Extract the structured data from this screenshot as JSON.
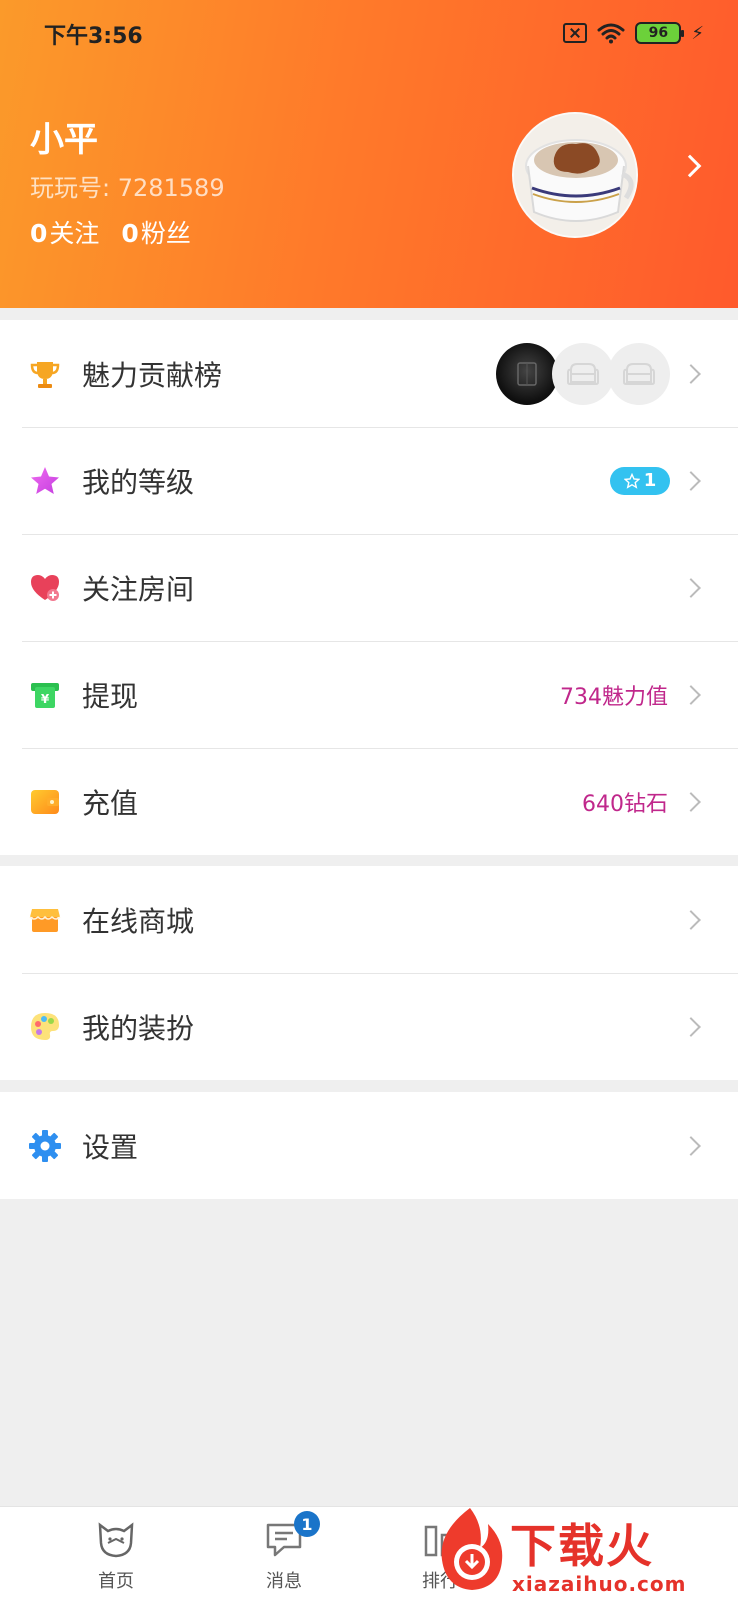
{
  "status_bar": {
    "time": "下午3:56",
    "battery": "96"
  },
  "profile": {
    "name": "小平",
    "id_label": "玩玩号: 7281589",
    "following_count": "0",
    "following_label": "关注",
    "fans_count": "0",
    "fans_label": "粉丝"
  },
  "menu": {
    "group1": [
      {
        "label": "魅力贡献榜",
        "icon": "trophy-icon"
      },
      {
        "label": "我的等级",
        "icon": "star-icon",
        "badge": "1"
      },
      {
        "label": "关注房间",
        "icon": "heart-icon"
      },
      {
        "label": "提现",
        "icon": "withdraw-icon",
        "value": "734魅力值"
      },
      {
        "label": "充值",
        "icon": "wallet-icon",
        "value": "640钻石"
      }
    ],
    "group2": [
      {
        "label": "在线商城",
        "icon": "shop-icon"
      },
      {
        "label": "我的装扮",
        "icon": "palette-icon"
      }
    ],
    "group3": [
      {
        "label": "设置",
        "icon": "gear-icon"
      }
    ]
  },
  "tabbar": {
    "home": "首页",
    "messages": "消息",
    "messages_badge": "1",
    "rank": "排行"
  },
  "watermark": {
    "title": "下载火",
    "domain": "xiazaihuo.com"
  },
  "colors": {
    "header_start": "#fb9a2a",
    "header_end": "#ff5a2c",
    "value_text": "#c0278b",
    "level_badge": "#33c2f0"
  }
}
